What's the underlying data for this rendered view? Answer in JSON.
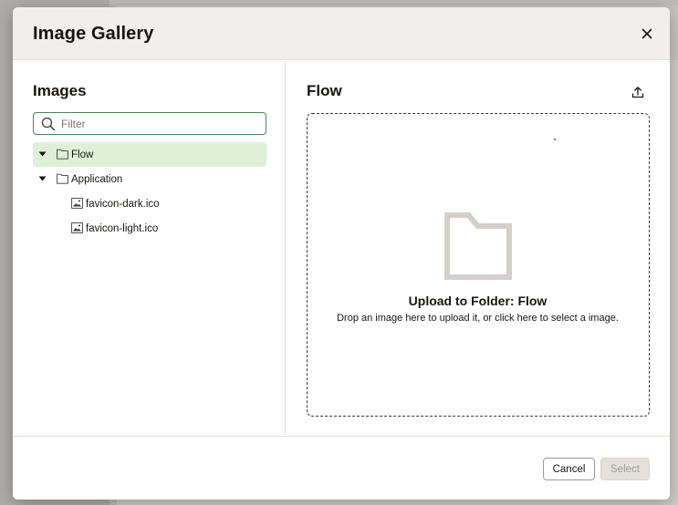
{
  "dialog": {
    "title": "Image Gallery",
    "close_icon": "close-icon"
  },
  "left_pane": {
    "heading": "Images",
    "filter": {
      "placeholder": "Filter",
      "value": "",
      "icon": "search-icon"
    },
    "tree": [
      {
        "label": "Flow",
        "type": "folder",
        "expanded": true,
        "selected": true,
        "level": 0
      },
      {
        "label": "Application",
        "type": "folder",
        "expanded": true,
        "selected": false,
        "level": 0
      },
      {
        "label": "favicon-dark.ico",
        "type": "image",
        "selected": false,
        "level": 1
      },
      {
        "label": "favicon-light.ico",
        "type": "image",
        "selected": false,
        "level": 1
      }
    ]
  },
  "right_pane": {
    "heading": "Flow",
    "upload_icon": "upload-icon",
    "dropzone": {
      "title": "Upload to Folder: Flow",
      "subtitle": "Drop an image here to upload it, or click here to select a image.",
      "icon": "folder-icon"
    }
  },
  "footer": {
    "cancel_label": "Cancel",
    "select_label": "Select"
  },
  "colors": {
    "accent_green_border": "#4c825c",
    "selected_row_bg": "#dff0d8",
    "header_bg": "#f1efed",
    "folder_gray": "#d4cfca"
  }
}
